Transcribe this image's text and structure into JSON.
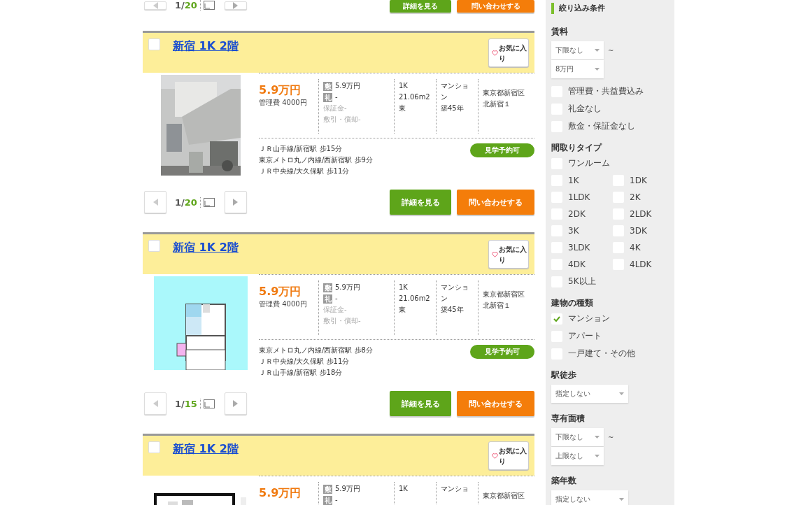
{
  "top_fragment": {
    "counter": "1",
    "separator": "/",
    "total": "20",
    "buttons": [
      {
        "kind": "detail",
        "label": "詳細を見る"
      },
      {
        "kind": "inquiry",
        "label": "問い合わせする"
      }
    ]
  },
  "listings": [
    {
      "title": "新宿 1K 2階",
      "checked": false,
      "favorite": "お気に入り",
      "kind": "picture",
      "price": "5.9万円",
      "management_fee": "管理費 4000円",
      "deposit_badge": "敷",
      "deposit": "5.9万円",
      "key_badge": "礼",
      "key_money": "-",
      "guarantee": "保証金-",
      "amortization": "敷引・償却-",
      "layout": "1K",
      "area": "21.06m2",
      "direction": "東",
      "building_type": "マンション",
      "age": "築45年",
      "address_lines": [
        "東京都新宿区",
        "北新宿１"
      ],
      "stations": [
        "ＪＲ山手線/新宿駅 歩15分",
        "東京メトロ丸ノ内線/西新宿駅 歩9分",
        "ＪＲ中央線/大久保駅 歩11分"
      ],
      "badge": "見学予約可",
      "counter": "1",
      "separator": "/",
      "total": "20",
      "buttons": [
        {
          "kind": "detail",
          "label": "詳細を見る"
        },
        {
          "kind": "inquiry",
          "label": "問い合わせする"
        }
      ]
    },
    {
      "title": "新宿 1K 2階",
      "checked": false,
      "favorite": "お気に入り",
      "kind": "picture",
      "price": "5.9万円",
      "management_fee": "管理費 4000円",
      "deposit_badge": "敷",
      "deposit": "5.9万円",
      "key_badge": "礼",
      "key_money": "-",
      "guarantee": "保証金-",
      "amortization": "敷引・償却-",
      "layout": "1K",
      "area": "21.06m2",
      "direction": "東",
      "building_type": "マンション",
      "age": "築45年",
      "address_lines": [
        "東京都新宿区",
        "北新宿１"
      ],
      "stations": [
        "東京メトロ丸ノ内線/西新宿駅 歩8分",
        "ＪＲ中央線/大久保駅 歩11分",
        "ＪＲ山手線/新宿駅 歩18分"
      ],
      "badge": "見学予約可",
      "counter": "1",
      "separator": "/",
      "total": "15",
      "buttons": [
        {
          "kind": "detail",
          "label": "詳細を見る"
        },
        {
          "kind": "inquiry",
          "label": "問い合わせする"
        }
      ]
    },
    {
      "title": "新宿 1K 2階",
      "checked": false,
      "favorite": "お気に入り",
      "kind": "picture",
      "price": "5.9万円",
      "deposit_badge": "敷",
      "deposit": "5.9万円",
      "key_badge": "礼",
      "key_money": "-",
      "layout": "1K",
      "building_type": "マンショ",
      "address_lines": [
        "東京都新宿区"
      ]
    }
  ],
  "filters": {
    "title": "絞り込み条件",
    "sections": [
      {
        "heading": "賃料",
        "range": {
          "selects": [
            "下限なし",
            "8万円"
          ],
          "separator": "~"
        },
        "options": [
          {
            "label": "管理費・共益費込み",
            "checked": false
          },
          {
            "label": "礼金なし",
            "checked": false
          },
          {
            "label": "敷金・保証金なし",
            "checked": false
          }
        ]
      },
      {
        "heading": "間取りタイプ",
        "kind": "grid",
        "options": [
          {
            "label": "ワンルーム",
            "checked": false,
            "full_row": true
          },
          {
            "label": "1K",
            "checked": false
          },
          {
            "label": "1DK",
            "checked": false
          },
          {
            "label": "1LDK",
            "checked": false
          },
          {
            "label": "2K",
            "checked": false
          },
          {
            "label": "2DK",
            "checked": false
          },
          {
            "label": "2LDK",
            "checked": false
          },
          {
            "label": "3K",
            "checked": false
          },
          {
            "label": "3DK",
            "checked": false
          },
          {
            "label": "3LDK",
            "checked": false
          },
          {
            "label": "4K",
            "checked": false
          },
          {
            "label": "4DK",
            "checked": false
          },
          {
            "label": "4LDK",
            "checked": false
          },
          {
            "label": "5K以上",
            "checked": false
          }
        ]
      },
      {
        "heading": "建物の種類",
        "options": [
          {
            "label": "マンション",
            "checked": true
          },
          {
            "label": "アパート",
            "checked": false
          },
          {
            "label": "一戸建て・その他",
            "checked": false
          }
        ]
      },
      {
        "heading": "駅徒歩",
        "select": "指定しない"
      },
      {
        "heading": "専有面積",
        "range": {
          "selects": [
            "下限なし",
            "上限なし"
          ],
          "separator": "~"
        }
      },
      {
        "heading": "築年数",
        "select": "指定しない"
      }
    ]
  }
}
